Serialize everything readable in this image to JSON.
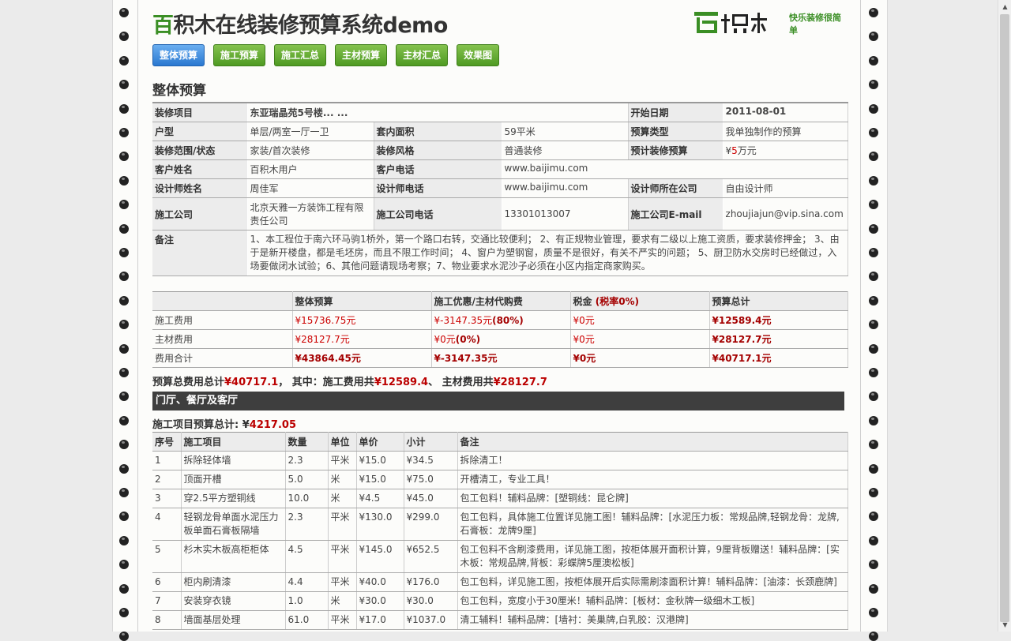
{
  "header": {
    "title_highlight": "百",
    "title_rest": "积木在线装修预算系统demo",
    "logo_text": "百积木",
    "slogan": "快乐装修很简单"
  },
  "tabs": [
    "整体预算",
    "施工预算",
    "施工汇总",
    "主材预算",
    "主材汇总",
    "效果图"
  ],
  "section_title": "整体预算",
  "info": {
    "project_label": "装修项目",
    "project_value": "东亚瑞晶苑5号楼... ...",
    "start_label": "开始日期",
    "start_value": "2011-08-01",
    "type_label": "户型",
    "type_value": "单层/两室一厅一卫",
    "area_label": "套内面积",
    "area_value": "59平米",
    "budget_type_label": "预算类型",
    "budget_type_value": "我单独制作的预算",
    "scope_label": "装修范围/状态",
    "scope_value": "家装/首次装修",
    "style_label": "装修风格",
    "style_value": "普通装修",
    "est_label": "预计装修预算",
    "est_prefix": "¥",
    "est_num": "5",
    "est_unit": "万元",
    "cust_label": "客户姓名",
    "cust_value": "百积木用户",
    "cust_phone_label": "客户电话",
    "cust_phone_value": "www.baijimu.com",
    "designer_label": "设计师姓名",
    "designer_value": "周佳军",
    "designer_phone_label": "设计师电话",
    "designer_phone_value": "www.baijimu.com",
    "designer_co_label": "设计师所在公司",
    "designer_co_value": "自由设计师",
    "co_label": "施工公司",
    "co_value": "北京天雅一方装饰工程有限责任公司",
    "co_phone_label": "施工公司电话",
    "co_phone_value": "13301013007",
    "co_email_label": "施工公司E-mail",
    "co_email_value": "zhoujiajun@vip.sina.com",
    "note_label": "备注",
    "note_value": "1、本工程位于南六环马驹1桥外，第一个路口右转，交通比较便利； 2、有正规物业管理，要求有二级以上施工资质，要求装修押金； 3、由于是新开楼盘，都是毛坯房，而且不限工作时间； 4、窗户为塑钢窗，质量不是很好，有关不严实的问题； 5、厨卫防水交房时已经做过，入场要做闭水试验；6、其他问题请现场考察；7、物业要求水泥沙子必须在小区内指定商家购买。"
  },
  "summary": {
    "headers": [
      "",
      "整体预算",
      "施工优惠/主材代购费",
      "税金",
      "(税率0%)",
      "预算总计"
    ],
    "rows": [
      {
        "label": "施工费用",
        "budget": "¥15736.75元",
        "discount": "¥-3147.35元",
        "discount_pct": "(80%)",
        "tax": "¥0元",
        "total": "¥12589.4元"
      },
      {
        "label": "主材费用",
        "budget": "¥28127.7元",
        "discount": "¥0元",
        "discount_pct": "(0%)",
        "tax": "¥0元",
        "total": "¥28127.7元"
      },
      {
        "label": "费用合计",
        "budget": "¥43864.45元",
        "discount": "¥-3147.35元",
        "discount_pct": "",
        "tax": "¥0元",
        "total": "¥40717.1元"
      }
    ]
  },
  "total_line": {
    "p1": "预算总费用总计",
    "v1": "¥40717.1",
    "p2": "， 其中：施工费用共",
    "v2": "¥12589.4",
    "p3": "、 主材费用共",
    "v3": "¥28127.7"
  },
  "room": {
    "title": "门厅、餐厅及客厅",
    "subtotal_label": "施工项目预算总计: ",
    "subtotal_prefix": "¥",
    "subtotal_value": "4217.05"
  },
  "items": {
    "headers": [
      "序号",
      "施工项目",
      "数量",
      "单位",
      "单价",
      "小计",
      "备注"
    ],
    "rows": [
      {
        "no": "1",
        "name": "拆除轻体墙",
        "qty": "2.3",
        "unit": "平米",
        "price": "¥15.0",
        "sub": "¥34.5",
        "note": "拆除清工！"
      },
      {
        "no": "2",
        "name": "顶面开槽",
        "qty": "5.0",
        "unit": "米",
        "price": "¥15.0",
        "sub": "¥75.0",
        "note": "开槽清工，专业工具！"
      },
      {
        "no": "3",
        "name": "穿2.5平方塑铜线",
        "qty": "10.0",
        "unit": "米",
        "price": "¥4.5",
        "sub": "¥45.0",
        "note": "包工包料！辅料品牌：[塑铜线：昆仑牌]"
      },
      {
        "no": "4",
        "name": "轻钢龙骨单面水泥压力板单面石膏板隔墙",
        "qty": "2.3",
        "unit": "平米",
        "price": "¥130.0",
        "sub": "¥299.0",
        "note": "包工包料，具体施工位置详见施工图！辅料品牌：[水泥压力板：常规品牌,轻钢龙骨：龙牌,石膏板：龙牌9厘]"
      },
      {
        "no": "5",
        "name": "杉木实木板高柜柜体",
        "qty": "4.5",
        "unit": "平米",
        "price": "¥145.0",
        "sub": "¥652.5",
        "note": "包工包料不含刷漆费用，详见施工图，按柜体展开面积计算，9厘背板赠送！辅料品牌：[实木板：常规品牌,背板：彩蝶牌5厘澳松板]"
      },
      {
        "no": "6",
        "name": "柜内刷清漆",
        "qty": "4.4",
        "unit": "平米",
        "price": "¥40.0",
        "sub": "¥176.0",
        "note": "包工包料，详见施工图，按柜体展开后实际需刷漆面积计算！辅料品牌：[油漆：长颈鹿牌]"
      },
      {
        "no": "7",
        "name": "安装穿衣镜",
        "qty": "1.0",
        "unit": "米",
        "price": "¥30.0",
        "sub": "¥30.0",
        "note": "包工包料，宽度小于30厘米！辅料品牌：[板材：金秋牌一级细木工板]"
      },
      {
        "no": "8",
        "name": "墙面基层处理",
        "qty": "61.0",
        "unit": "平米",
        "price": "¥17.0",
        "sub": "¥1037.0",
        "note": "清工辅料！辅料品牌：[墙衬：美巢牌,白乳胶：汉港牌]"
      }
    ]
  }
}
